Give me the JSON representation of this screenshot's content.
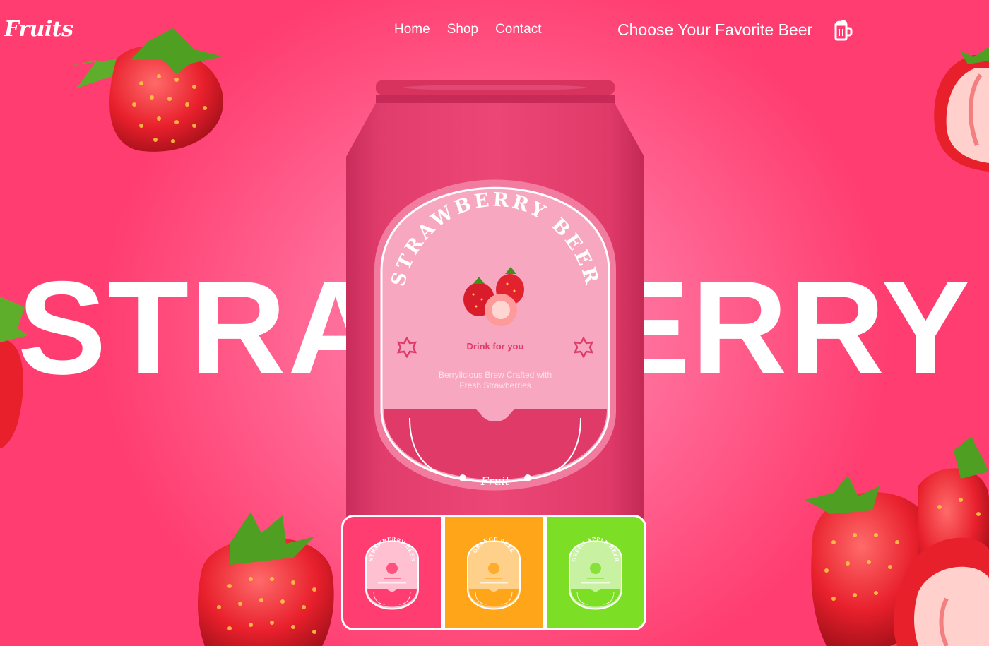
{
  "header": {
    "logo": "Fruits",
    "nav": [
      "Home",
      "Shop",
      "Contact"
    ],
    "choose": "Choose Your Favorite Beer",
    "cart_icon": "beer-mug-icon"
  },
  "hero": {
    "big_word": "STRAWBERRY"
  },
  "can": {
    "arc_title": "STRAWBERRY BEER",
    "tagline": "Drink for you",
    "desc_line1": "Berrylicious Brew Crafted with",
    "desc_line2": "Fresh Strawberries",
    "brand": "Fruit"
  },
  "variants": [
    {
      "name": "STRAWBERRY BEER",
      "color": "#ff3d70",
      "label": "#ffc0d1",
      "accent": "#ff3d70",
      "fruit": "strawberry-icon"
    },
    {
      "name": "ORANGE BEER",
      "color": "#ffa51a",
      "label": "#ffd08a",
      "accent": "#ffa51a",
      "fruit": "orange-icon"
    },
    {
      "name": "GREEN APPLE BEER",
      "color": "#7dde26",
      "label": "#c8f2a1",
      "accent": "#7dde26",
      "fruit": "green-apple-icon"
    }
  ],
  "colors": {
    "background": "#ff4f7d",
    "can": "#e53b6c",
    "label": "#f7a7bf"
  }
}
